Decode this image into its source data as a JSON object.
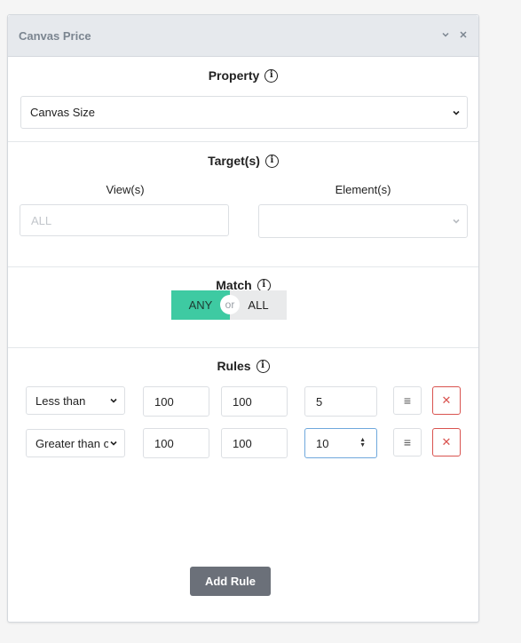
{
  "panel": {
    "title": "Canvas Price",
    "collapse_icon": "chevron-down-icon",
    "close_icon": "close-icon"
  },
  "property": {
    "title": "Property",
    "selected": "Canvas Size"
  },
  "targets": {
    "title": "Target(s)",
    "views_label": "View(s)",
    "views_placeholder": "ALL",
    "elements_label": "Element(s)",
    "elements_value": ""
  },
  "match": {
    "title": "Match",
    "any_label": "ANY",
    "or_label": "or",
    "all_label": "ALL",
    "selected": "ANY"
  },
  "rules": {
    "title": "Rules",
    "rows": [
      {
        "condition": "Less than",
        "width": "100",
        "height": "100",
        "price": "5"
      },
      {
        "condition": "Greater than o",
        "width": "100",
        "height": "100",
        "price": "10"
      }
    ]
  },
  "add_rule_label": "Add Rule",
  "colors": {
    "accent": "#3ecaa2",
    "danger": "#d9534f",
    "button": "#6b7079"
  }
}
